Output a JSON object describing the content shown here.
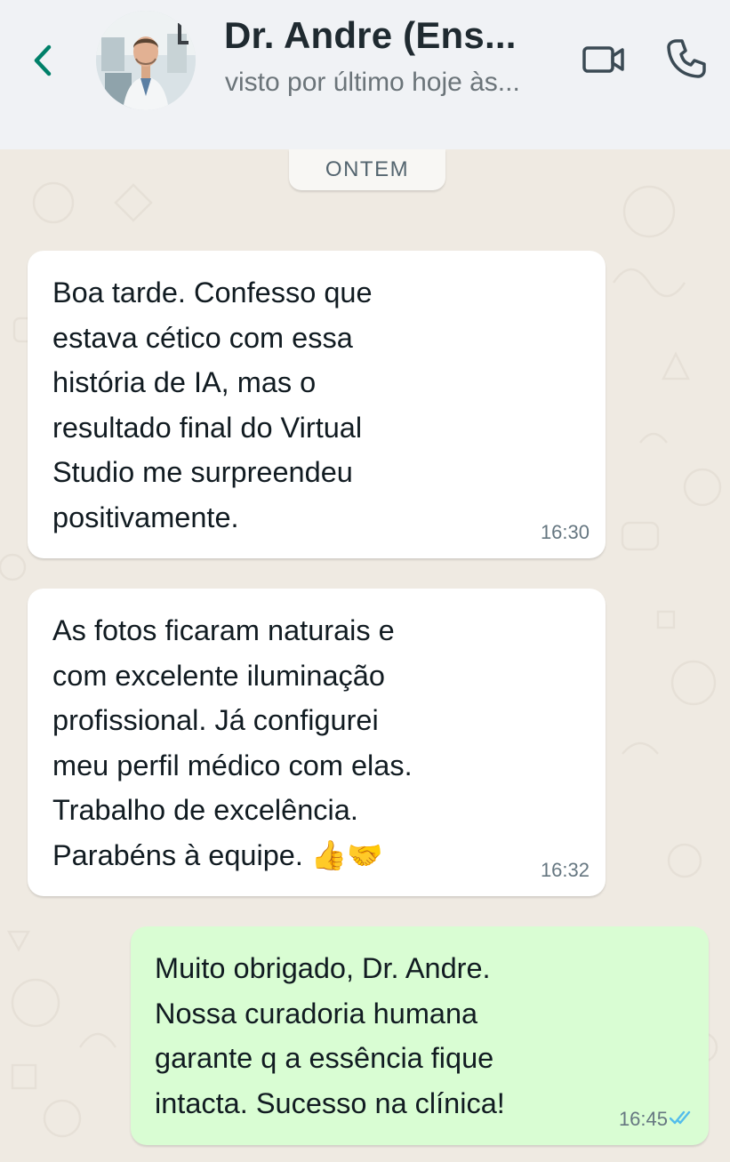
{
  "header": {
    "back_label": "Voltar",
    "contact_name": "Dr. Andre (Ens...",
    "status": "visto por último hoje às...",
    "icons": {
      "back": "chevron-left-icon",
      "video": "video-camera-icon",
      "call": "phone-icon"
    }
  },
  "chat": {
    "date_separator": "ONTEM",
    "messages": [
      {
        "direction": "incoming",
        "text": "Boa tarde. Confesso que\nestava cético com essa\nhistória de IA, mas o\nresultado final do Virtual\nStudio me surpreendeu\npositivamente.",
        "time": "16:30"
      },
      {
        "direction": "incoming",
        "text": "As fotos ficaram naturais e\ncom excelente iluminação\nprofissional. Já configurei\nmeu perfil médico com elas.\nTrabalho de excelência.\nParabéns à equipe. 👍🤝",
        "time": "16:32"
      },
      {
        "direction": "outgoing",
        "text": "Muito obrigado, Dr. Andre.\nNossa curadoria humana\ngarante q a essência fique\nintacta. Sucesso na clínica!",
        "time": "16:45",
        "status_icon": "double-check-read-icon"
      }
    ]
  },
  "colors": {
    "header_bg": "#f0f2f5",
    "chat_bg": "#efeae2",
    "incoming_bubble": "#ffffff",
    "outgoing_bubble": "#d9fdd3",
    "accent": "#008069",
    "read_ticks": "#53bdeb"
  }
}
